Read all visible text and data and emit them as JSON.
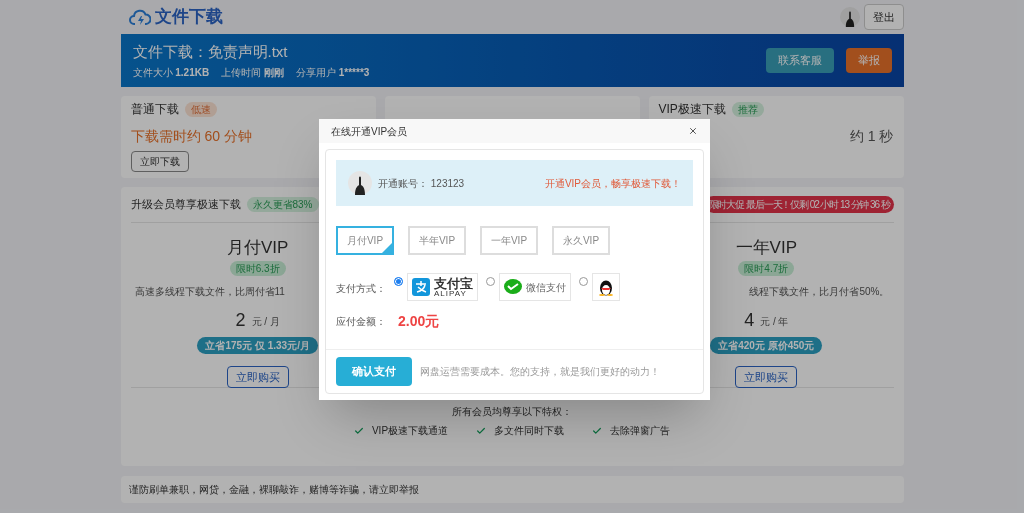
{
  "header": {
    "logo_text": "文件下载",
    "logout": "登出"
  },
  "banner": {
    "title": "文件下载：免责声明.txt",
    "meta": [
      {
        "label": "文件大小",
        "value": "1.21KB"
      },
      {
        "label": "上传时间",
        "value": "刚刚"
      },
      {
        "label": "分享用户",
        "value": "1*****3"
      }
    ],
    "buttons": [
      {
        "label": "联系客服",
        "kind": "teal"
      },
      {
        "label": "举报",
        "kind": "orange"
      }
    ]
  },
  "download_cards": [
    {
      "title": "普通下载",
      "badge": "低速",
      "time": "下载需时约 60 分钟",
      "button": "立即下载"
    },
    {
      "title": "VIP极速下载",
      "badge": "推荐",
      "time": "约 1 秒"
    }
  ],
  "plans": {
    "title": "升级会员尊享极速下载",
    "badge": "永久更省83%",
    "promo": "限时大促 最后一天！仅剩 02 小时 13 分钟 36 秒",
    "columns": [
      {
        "name": "月付VIP",
        "discount": "限时6.3折",
        "desc": "高速多线程下载文件，比周付省11",
        "price": "2",
        "unit": "元 / 月",
        "saving": "立省175元 仅 1.33元/月",
        "button": "立即购买"
      },
      {
        "name": "一年VIP",
        "discount": "限时4.7折",
        "desc": "线程下载文件，比月付省50%。",
        "price": "4",
        "unit": "元 / 年",
        "saving": "立省420元 原价450元",
        "button": "立即购买"
      }
    ],
    "perks_title": "所有会员均尊享以下特权：",
    "perks": [
      "VIP极速下载通道",
      "多文件同时下载",
      "去除弹窗广告"
    ]
  },
  "notice": "谨防刷单兼职，网贷，金融，裸聊敲诈，赌博等诈骗，请立即举报",
  "modal": {
    "title": "在线开通VIP会员",
    "account_label": "开通账号：",
    "account": "123123",
    "slogan": "开通VIP会员，畅享极速下载！",
    "options": [
      {
        "label": "月付VIP",
        "selected": true
      },
      {
        "label": "半年VIP",
        "selected": false
      },
      {
        "label": "一年VIP",
        "selected": false
      },
      {
        "label": "永久VIP",
        "selected": false
      }
    ],
    "pay_label": "支付方式：",
    "methods": [
      {
        "kind": "alipay",
        "name": "支付宝",
        "sub": "ALIPAY",
        "selected": true
      },
      {
        "kind": "wechat",
        "name": "微信支付",
        "selected": false
      },
      {
        "kind": "qq",
        "selected": false
      }
    ],
    "amount_label": "应付金额：",
    "amount": "2.00元",
    "confirm": "确认支付",
    "note": "网盘运营需要成本。您的支持，就是我们更好的动力！"
  }
}
